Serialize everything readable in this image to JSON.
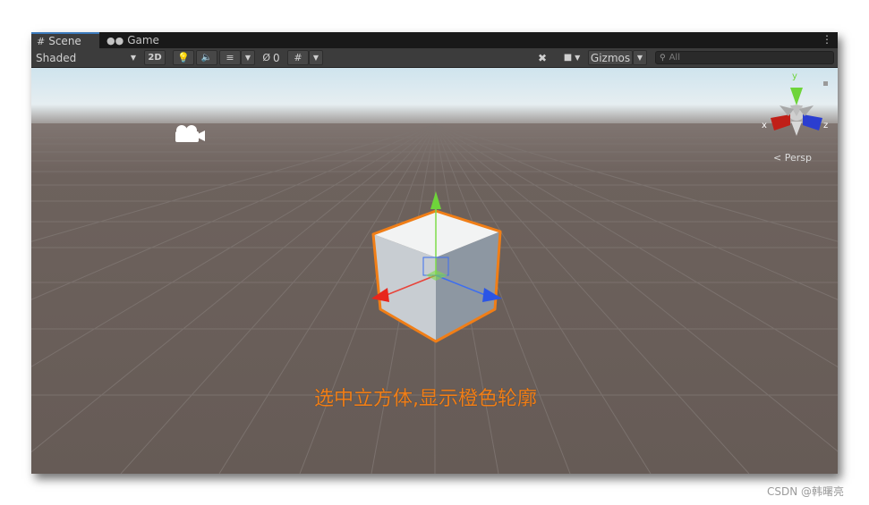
{
  "tabs": [
    {
      "label": "Scene",
      "icon": "grid-icon",
      "active": true
    },
    {
      "label": "Game",
      "icon": "gamepad-icon",
      "active": false
    }
  ],
  "toolbar": {
    "shading_mode": "Shaded",
    "toggle_2d": "2D",
    "hidden_count": "0",
    "gizmos_label": "Gizmos",
    "search_placeholder": "All"
  },
  "viewport": {
    "persp_label": "Persp",
    "axis_x": "x",
    "axis_y": "y",
    "axis_z": "z",
    "caption": "选中立方体,显示橙色轮廓",
    "selection_color": "#f07e17",
    "sky_color": "#cfe4ee",
    "ground_color": "#6b5f5a"
  },
  "watermark": "CSDN @韩曙亮"
}
